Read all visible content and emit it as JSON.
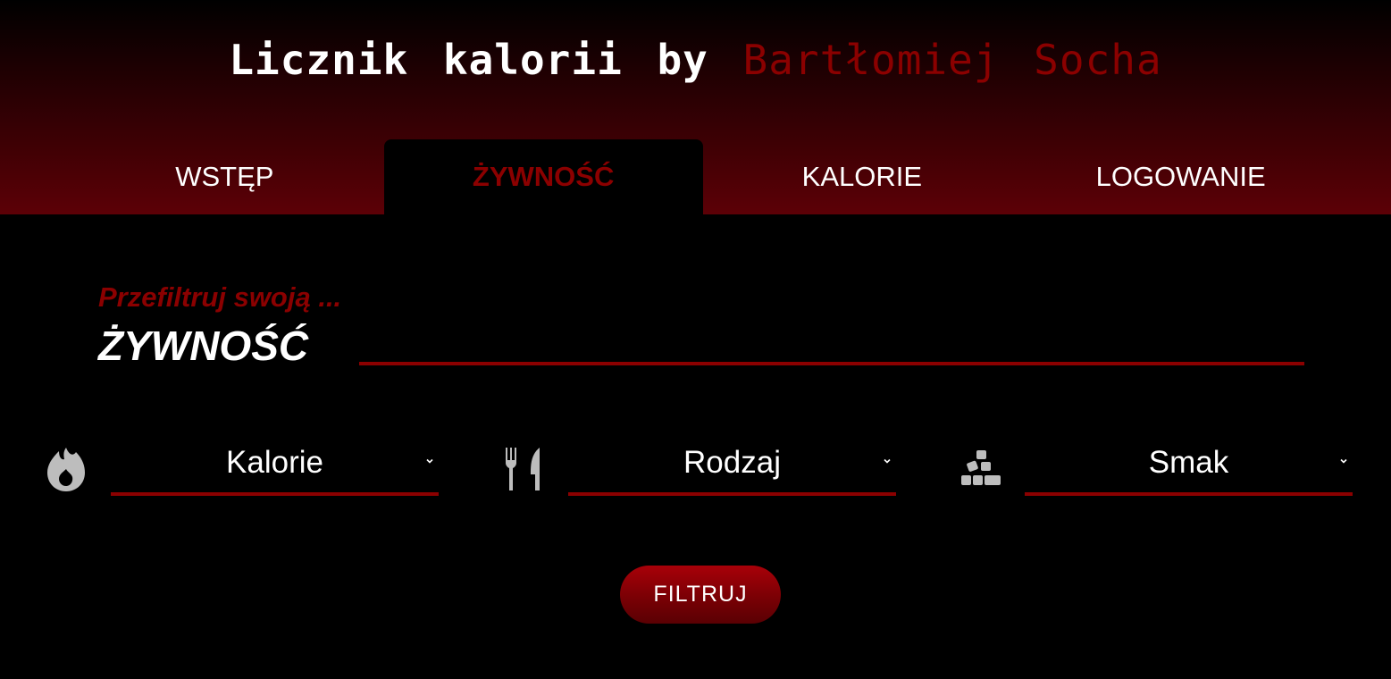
{
  "header": {
    "title_prefix": "Licznik kalorii by",
    "title_author": "Bartłomiej Socha"
  },
  "nav": {
    "tabs": [
      {
        "label": "WSTĘP",
        "active": false
      },
      {
        "label": "ŻYWNOŚĆ",
        "active": true
      },
      {
        "label": "KALORIE",
        "active": false
      },
      {
        "label": "LOGOWANIE",
        "active": false
      }
    ]
  },
  "filter": {
    "subtitle": "Przefiltruj swoją ...",
    "title": "ŻYWNOŚĆ",
    "selects": [
      {
        "icon": "fire-icon",
        "value": "Kalorie"
      },
      {
        "icon": "utensils-icon",
        "value": "Rodzaj"
      },
      {
        "icon": "cubes-icon",
        "value": "Smak"
      }
    ],
    "button_label": "FILTRUJ"
  },
  "colors": {
    "accent": "#8b0000",
    "background": "#000000",
    "text": "#ffffff",
    "icon": "#bdbdbd"
  }
}
